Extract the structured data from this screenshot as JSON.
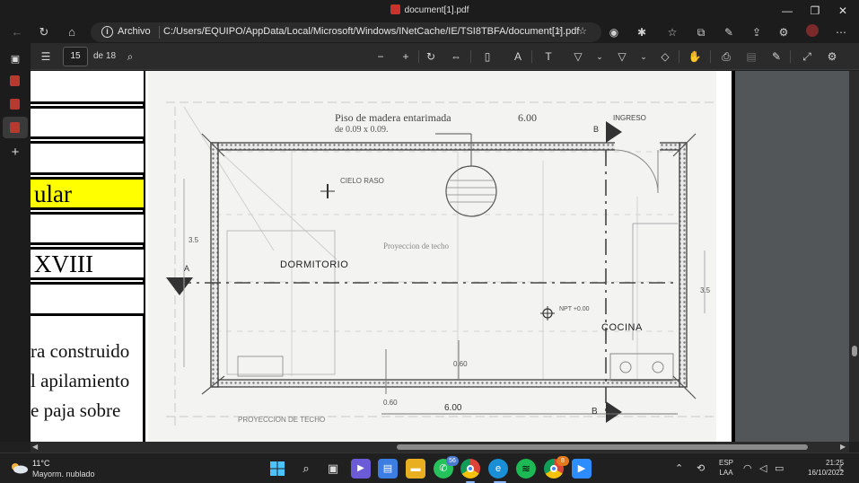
{
  "window": {
    "title": "document[1].pdf",
    "minimize": "—",
    "maximize": "❐",
    "close": "✕"
  },
  "address_bar": {
    "site_label": "Archivo",
    "url": "C:/Users/EQUIPO/AppData/Local/Microsoft/Windows/INetCache/IE/TSI8TBFA/document[1].pdf"
  },
  "pdf_toolbar": {
    "current_page": "15",
    "page_count_label": "de 18"
  },
  "document": {
    "table_cells": [
      "",
      "",
      "",
      "ular",
      "",
      "XVIII",
      ""
    ],
    "yellow_cell_index": 3,
    "paragraph_lines": [
      "ra construido",
      "l apilamiento",
      "e paja sobre"
    ],
    "drawing_labels": {
      "header_note": "Piso de madera entarimada",
      "header_dim": "6.00",
      "header_sub": "de 0.09 x 0.09.",
      "top_right": "INGRESO",
      "cielo": "CIELO RASO",
      "room_1": "DORMITORIO",
      "room_2": "COCINA",
      "projection_mid": "Proyeccion de techo",
      "projection_bottom": "PROYECCION DE TECHO",
      "bottom_dim": "6.00",
      "left_dim": "3.5",
      "right_dim": "3.5",
      "dim_060_a": "0.60",
      "dim_060_b": "0.60",
      "marker_a": "A",
      "marker_b_top": "B",
      "marker_b_bottom": "B",
      "npt": "NPT +0.00"
    }
  },
  "taskbar": {
    "weather_temp": "11°C",
    "weather_cond": "Mayorm. nublado",
    "whatsapp_badge": "56",
    "chrome_badge": "8",
    "lang_1": "ESP",
    "lang_2": "LAA",
    "time": "21:25",
    "date": "16/10/2022"
  },
  "colors": {
    "chrome_bg": "#1c1c1c",
    "toolbar_bg": "#2b2b2b",
    "highlight_yellow": "#ffff00",
    "pdf_red": "#c8342b"
  }
}
